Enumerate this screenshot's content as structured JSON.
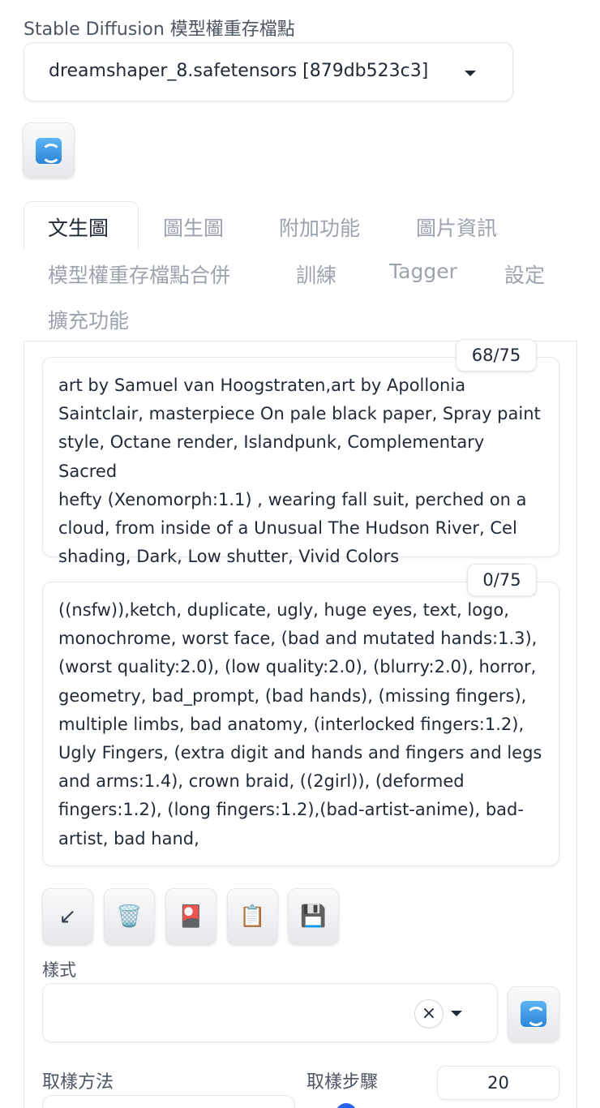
{
  "model": {
    "label": "Stable Diffusion 模型權重存檔點",
    "selected": "dreamshaper_8.safetensors [879db523c3]"
  },
  "tabs": [
    {
      "label": "文生圖",
      "active": true
    },
    {
      "label": "圖生圖"
    },
    {
      "label": "附加功能"
    },
    {
      "label": "圖片資訊"
    },
    {
      "label": "模型權重存檔點合併"
    },
    {
      "label": "訓練"
    },
    {
      "label": "Tagger"
    },
    {
      "label": "設定"
    },
    {
      "label": "擴充功能"
    }
  ],
  "prompt": {
    "counter": "68/75",
    "lines": [
      "art by Samuel van Hoogstraten,art by Apollonia",
      "Saintclair, masterpiece On pale black paper, Spray paint",
      "style, Octane render, Islandpunk, Complementary Sacred",
      "hefty (Xenomorph:1.1) , wearing fall suit, perched on a",
      "cloud, from inside of a Unusual The Hudson River, Cel",
      "shading, Dark, Low shutter, Vivid Colors"
    ]
  },
  "negative_prompt": {
    "counter": "0/75",
    "lines": [
      "((nsfw)),ketch, duplicate, ugly, huge eyes, text, logo,",
      "monochrome, worst face, (bad and mutated hands:1.3),",
      "(worst quality:2.0), (low quality:2.0), (blurry:2.0), horror,",
      "geometry, bad_prompt, (bad hands), (missing fingers),",
      "multiple limbs, bad anatomy, (interlocked fingers:1.2),",
      "Ugly Fingers, (extra digit and hands and fingers and legs",
      "and arms:1.4), crown braid, ((2girl)), (deformed",
      "fingers:1.2), (long fingers:1.2),(bad-artist-anime), bad-",
      "artist, bad hand,"
    ]
  },
  "toolbar": {
    "read_params_icon": "↙",
    "trash_icon": "🗑️",
    "style_apply_icon": "🎴",
    "clipboard_icon": "📋",
    "save_icon": "💾"
  },
  "styles": {
    "label": "樣式",
    "value": "",
    "clear_glyph": "×"
  },
  "sampler": {
    "label": "取樣方法"
  },
  "steps": {
    "label": "取樣步驟",
    "value": "20"
  }
}
